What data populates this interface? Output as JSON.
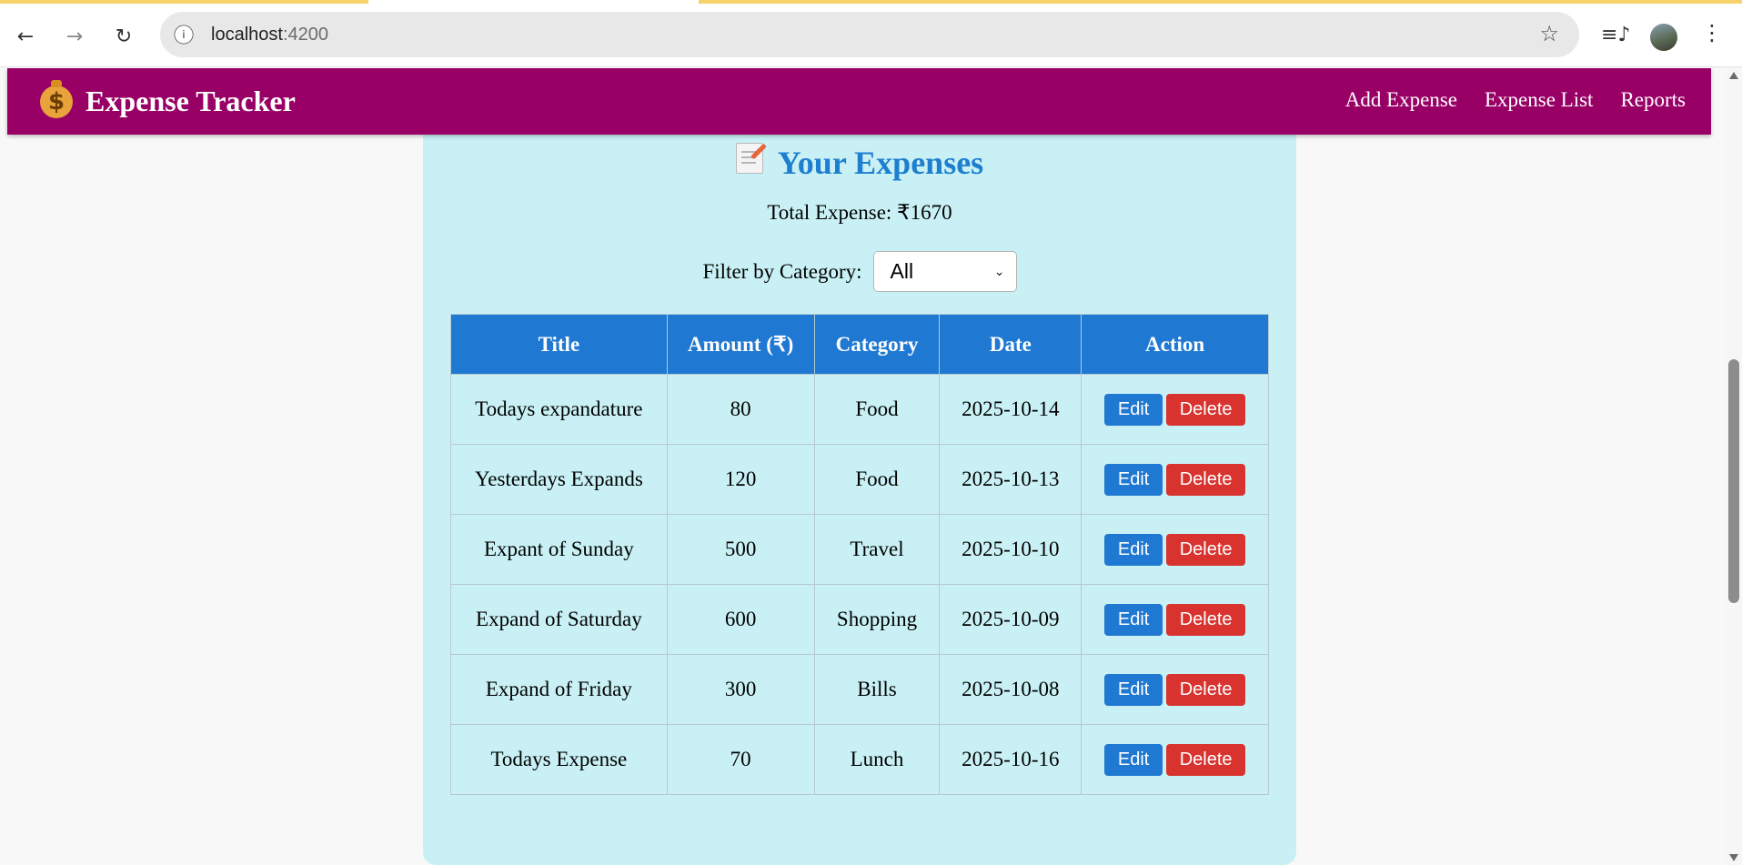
{
  "browser": {
    "url_host": "localhost",
    "url_port": ":4200",
    "icons": {
      "back": "arrow-left-icon",
      "forward": "arrow-right-icon",
      "reload": "reload-icon",
      "info": "info-icon",
      "bookmark": "star-icon",
      "media": "media-controls-icon",
      "menu": "more-vert-icon"
    }
  },
  "app": {
    "brand": "Expense Tracker",
    "brand_icon": "money-bag-icon",
    "nav": [
      "Add Expense",
      "Expense List",
      "Reports"
    ],
    "colors": {
      "navbar": "#990066",
      "primary": "#1f78d1",
      "danger": "#d8332f",
      "card": "#c9f1f5"
    }
  },
  "page": {
    "heading": "Your Expenses",
    "heading_icon": "memo-icon",
    "total_label": "Total Expense: ₹1670",
    "filter_label": "Filter by Category:",
    "filter_value": "All"
  },
  "table": {
    "headers": [
      "Title",
      "Amount (₹)",
      "Category",
      "Date",
      "Action"
    ],
    "rows": [
      {
        "title": "Todays expandature",
        "amount": "80",
        "category": "Food",
        "date": "2025-10-14"
      },
      {
        "title": "Yesterdays Expands",
        "amount": "120",
        "category": "Food",
        "date": "2025-10-13"
      },
      {
        "title": "Expant of Sunday",
        "amount": "500",
        "category": "Travel",
        "date": "2025-10-10"
      },
      {
        "title": "Expand of Saturday",
        "amount": "600",
        "category": "Shopping",
        "date": "2025-10-09"
      },
      {
        "title": "Expand of Friday",
        "amount": "300",
        "category": "Bills",
        "date": "2025-10-08"
      },
      {
        "title": "Todays Expense",
        "amount": "70",
        "category": "Lunch",
        "date": "2025-10-16"
      }
    ],
    "edit_label": "Edit",
    "delete_label": "Delete"
  }
}
